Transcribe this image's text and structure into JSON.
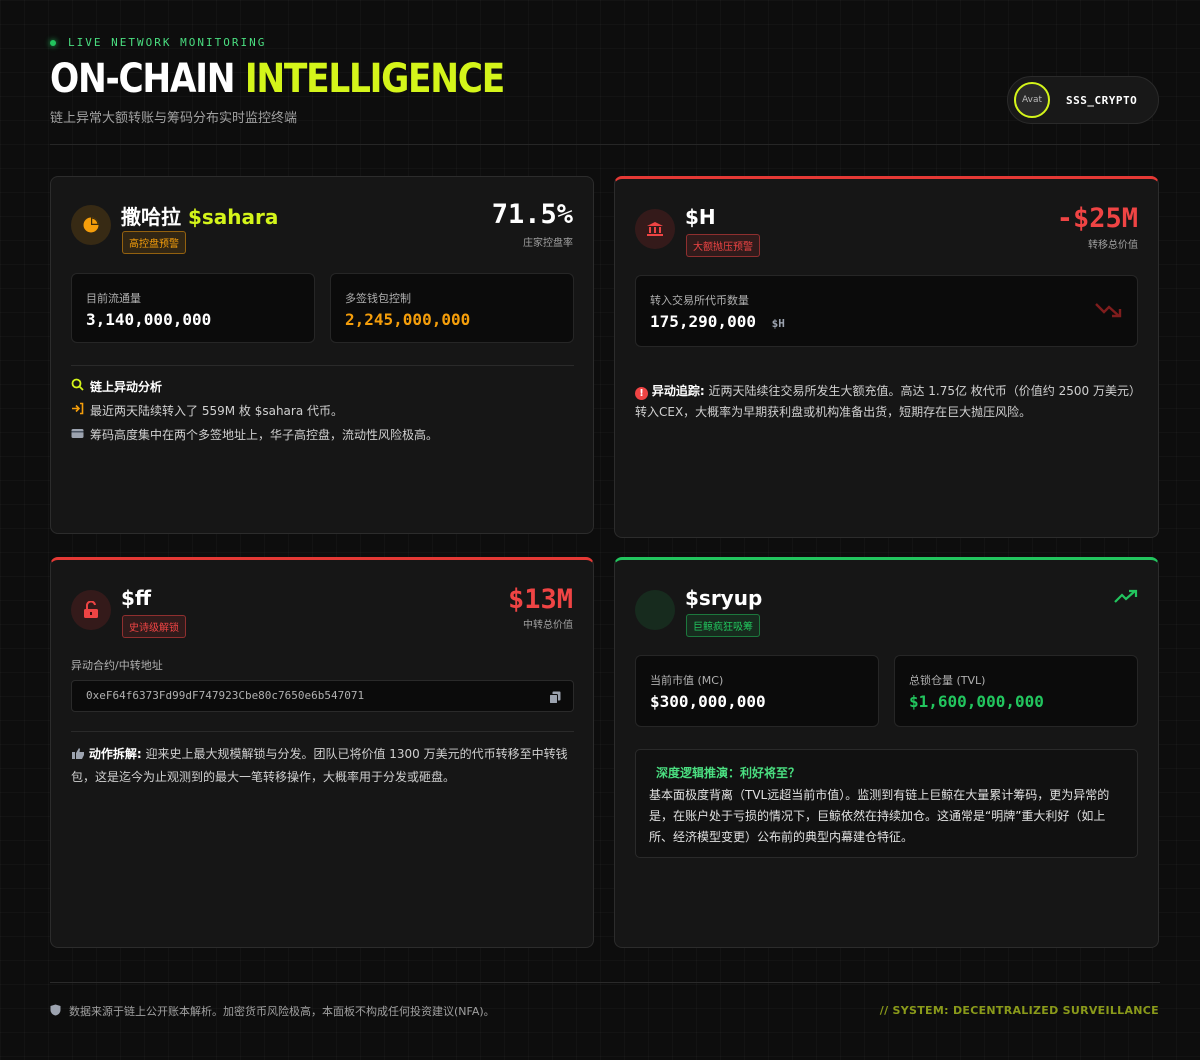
{
  "header": {
    "live_label": "LIVE NETWORK MONITORING",
    "title_white": "ON-CHAIN ",
    "title_yellow": "INTELLIGENCE",
    "subtitle": "链上异常大额转账与筹码分布实时监控终端",
    "avatar_alt": "Avat",
    "username": "SSS_CRYPTO"
  },
  "cards": {
    "sahara": {
      "name": "撒哈拉 ",
      "ticker": "$sahara",
      "badge": "高控盘预警",
      "big_value": "71.5%",
      "big_label": "庄家控盘率",
      "stat1_label": "目前流通量",
      "stat1_value": "3,140,000,000",
      "stat2_label": "多签钱包控制",
      "stat2_value": "2,245,000,000",
      "analysis_title": "链上异动分析",
      "line1": "最近两天陆续转入了 559M 枚 $sahara 代币。",
      "line2": "筹码高度集中在两个多签地址上，华子高控盘，流动性风险极高。",
      "icon": "pie-chart-icon"
    },
    "h": {
      "name": "$H",
      "badge": "大额抛压预警",
      "big_value": "-$25M",
      "big_label": "转移总价值",
      "stat_label": "转入交易所代币数量",
      "stat_value": "175,290,000",
      "stat_unit": "$H",
      "trace_label": "异动追踪:",
      "trace_text": " 近两天陆续往交易所发生大额充值。高达 1.75亿 枚代币（价值约 2500 万美元）转入CEX，大概率为早期获利盘或机构准备出货，短期存在巨大抛压风险。",
      "icon": "bank-icon"
    },
    "ff": {
      "name": "$ff",
      "badge": "史诗级解锁",
      "big_value": "$13M",
      "big_label": "中转总价值",
      "addr_label": "异动合约/中转地址",
      "address": "0xeF64f6373Fd99dF747923Cbe80c7650e6b547071",
      "action_label": "动作拆解:",
      "action_text": " 迎来史上最大规模解锁与分发。团队已将价值 1300 万美元的代币转移至中转钱包，这是迄今为止观测到的最大一笔转移操作，大概率用于分发或砸盘。",
      "icon": "unlock-icon"
    },
    "sryup": {
      "name": "$sryup",
      "badge": "巨鲸疯狂吸筹",
      "stat1_label": "当前市值 (MC)",
      "stat1_value": "$300,000,000",
      "stat2_label": "总锁仓量 (TVL)",
      "stat2_value": "$1,600,000,000",
      "deep_title": "深度逻辑推演：利好将至？",
      "deep_text": "基本面极度背离（TVL远超当前市值）。监测到有链上巨鲸在大量累计筹码，更为异常的是，在账户处于亏损的情况下，巨鲸依然在持续加仓。这通常是“明牌”重大利好（如上所、经济模型变更）公布前的典型内幕建仓特征。"
    }
  },
  "footer": {
    "disclaimer": "数据来源于链上公开账本解析。加密货币风险极高，本面板不构成任何投资建议(NFA)。",
    "system": "// SYSTEM: DECENTRALIZED SURVEILLANCE"
  },
  "colors": {
    "accent_yellow": "#d4f51a",
    "red": "#e53935",
    "green": "#22c55e",
    "orange": "#f59e0b"
  }
}
